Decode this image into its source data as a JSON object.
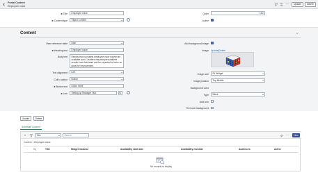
{
  "header": {
    "record_type": "Portal Content",
    "record_name": "Employee voice",
    "update_label": "Update",
    "delete_label": "Delete"
  },
  "form": {
    "title_label": "Title",
    "title_value": "Employee voice",
    "content_type_label": "Content type",
    "content_type_value": "Styled Content",
    "order_label": "Order",
    "order_value": "100",
    "active_label": "Active",
    "active_checked": true
  },
  "content": {
    "section_title": "Content",
    "user_reference_table_label": "User reference table",
    "user_reference_table_value": "User",
    "heading_text_label": "Heading text",
    "heading_text_value": "Employee voice",
    "body_text_label": "Body text",
    "body_text_value": "Results from our latest employee voice survey are available soon. Leaders may see personalized results from their team and be expected to focus on goals for improvement.",
    "text_alignment_label": "Text alignment",
    "text_alignment_value": "Left",
    "call_to_action_label": "Call to action",
    "call_to_action_value": "Button",
    "button_text_label": "Button text",
    "button_text_value": "Learn more",
    "link_label": "Link",
    "link_value": "Setting up Manager Hub",
    "add_bg_image_label": "Add background image",
    "add_bg_image_checked": true,
    "image_label": "Image",
    "image_update": "Update",
    "image_delete": "Delete",
    "image_size_label": "Image size",
    "image_size_value": "Fit Widget",
    "image_position_label": "Image position",
    "image_position_value": "Top Middle",
    "background_color_label": "Background color",
    "type_label": "Type",
    "type_value": "Block",
    "add_icon_label": "Add icon",
    "text_over_bg_label": "Text over background"
  },
  "actions": {
    "update_label": "Update",
    "delete_label": "Delete"
  },
  "related": {
    "tab_label": "Schedule Content",
    "filter_field": "Title",
    "search_placeholder": "Search",
    "new_label": "New",
    "breadcrumb": "Content = Employee voice",
    "columns": [
      "Title",
      "Widget instance",
      "Availability start date",
      "Availability end date",
      "Audiences",
      "Active"
    ],
    "empty_text": "No records to display"
  },
  "colors": {
    "primary": "#384c8b",
    "checkbox_on": "#4b63a6",
    "link": "#2e66b6",
    "tab_accent": "#2e7d5b"
  }
}
